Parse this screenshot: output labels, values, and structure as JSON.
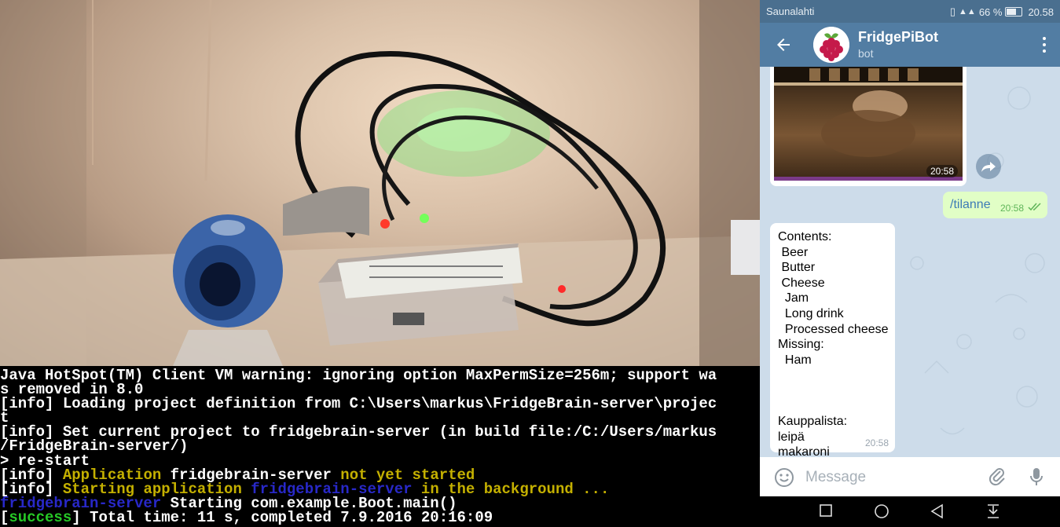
{
  "terminal": {
    "lines": [
      {
        "segments": [
          {
            "text": "Java HotSpot(TM) Client VM warning: ignoring option MaxPermSize=256m; support wa",
            "color": "white"
          }
        ]
      },
      {
        "segments": [
          {
            "text": "s removed in 8.0",
            "color": "white"
          }
        ]
      },
      {
        "segments": [
          {
            "text": "[info] Loading project definition from C:\\Users\\markus\\FridgeBrain-server\\projec",
            "color": "white"
          }
        ]
      },
      {
        "segments": [
          {
            "text": "t",
            "color": "white"
          }
        ]
      },
      {
        "segments": [
          {
            "text": "[info] Set current project to fridgebrain-server (in build file:/C:/Users/markus",
            "color": "white"
          }
        ]
      },
      {
        "segments": [
          {
            "text": "/FridgeBrain-server/)",
            "color": "white"
          }
        ]
      },
      {
        "segments": [
          {
            "text": "> re-start",
            "color": "white"
          }
        ]
      },
      {
        "segments": [
          {
            "text": "[info] ",
            "color": "white"
          },
          {
            "text": "Application ",
            "color": "yellow"
          },
          {
            "text": "fridgebrain-server ",
            "color": "white"
          },
          {
            "text": "not yet started",
            "color": "yellow"
          }
        ]
      },
      {
        "segments": [
          {
            "text": "[info] ",
            "color": "white"
          },
          {
            "text": "Starting application ",
            "color": "yellow"
          },
          {
            "text": "fridgebrain-server",
            "color": "blue"
          },
          {
            "text": " in the background ...",
            "color": "yellow"
          }
        ]
      },
      {
        "segments": [
          {
            "text": "fridgebrain-server",
            "color": "blue"
          },
          {
            "text": " Starting com.example.Boot.main()",
            "color": "white"
          }
        ]
      },
      {
        "segments": [
          {
            "text": "[",
            "color": "white"
          },
          {
            "text": "success",
            "color": "green"
          },
          {
            "text": "] Total time: 11 s, completed 7.9.2016 20:16:09",
            "color": "white"
          }
        ]
      }
    ]
  },
  "statusbar": {
    "carrier": "Saunalahti",
    "signal_text": "¹⁴ᴳ",
    "battery": "66 %",
    "time": "20.58"
  },
  "appbar": {
    "title": "FridgePiBot",
    "subtitle": "bot"
  },
  "messages": {
    "photo_time": "20:58",
    "outgoing_text": "/tilanne",
    "outgoing_time": "20:58",
    "incoming_text": "Contents:\n Beer\n Butter\n Cheese\n  Jam\n  Long drink\n  Processed cheese\nMissing:\n  Ham\n\n\n\nKauppalista:\nleipä\nmakaroni",
    "incoming_time": "20:58"
  },
  "input": {
    "placeholder": "Message"
  },
  "colors": {
    "appbar": "#527da3",
    "statusbar": "#4a6f8f",
    "outgoing_bubble": "#e1fec6",
    "link": "#3d7bb6"
  },
  "icons": {
    "back": "arrow-left-icon",
    "menu": "more-vert-icon",
    "share": "share-icon",
    "emoji": "emoji-icon",
    "attach": "paperclip-icon",
    "mic": "microphone-icon",
    "nav_recent": "square-icon",
    "nav_home": "circle-icon",
    "nav_back": "triangle-icon",
    "nav_notif": "pull-down-icon"
  }
}
